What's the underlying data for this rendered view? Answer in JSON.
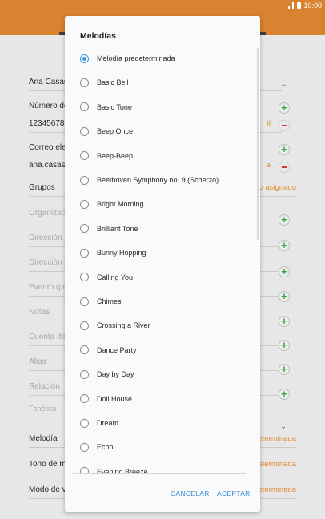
{
  "status": {
    "time": "10:00"
  },
  "form": {
    "name_value": "Ana Casas",
    "phone_label": "Número de",
    "phone_value": "123456789",
    "phone_type": "il",
    "email_label": "Correo elec",
    "email_value": "ana.casas.",
    "email_type": "a",
    "groups_label": "Grupos",
    "groups_value": "o asignado",
    "org_label": "Organizació",
    "address_label": "Dirección",
    "web_label": "Dirección w",
    "event_label": "Evento (po",
    "notes_label": "Notas",
    "account_label": "Cuenta de",
    "alias_label": "Alias",
    "relation_label": "Relación",
    "phonetic_label": "Fonética",
    "ringtone_label": "Melodía",
    "ringtone_value": "eterminada",
    "msgtone_label": "Tono de m",
    "msgtone_value": "eterminada",
    "vibration_label": "Modo de vi",
    "vibration_value": "eterminada"
  },
  "dialog": {
    "title": "Melodías",
    "selected_index": 0,
    "options": [
      "Melodía predeterminada",
      "Basic Bell",
      "Basic Tone",
      "Beep Once",
      "Beep-Beep",
      "Beethoven Symphony no. 9 (Scherzo)",
      "Bright Morning",
      "Brilliant Tone",
      "Bunny Hopping",
      "Calling You",
      "Chimes",
      "Crossing a River",
      "Dance Party",
      "Day by Day",
      "Doll House",
      "Dream",
      "Echo",
      "Evening Breeze"
    ],
    "cancel_label": "CANCELAR",
    "accept_label": "ACEPTAR"
  }
}
